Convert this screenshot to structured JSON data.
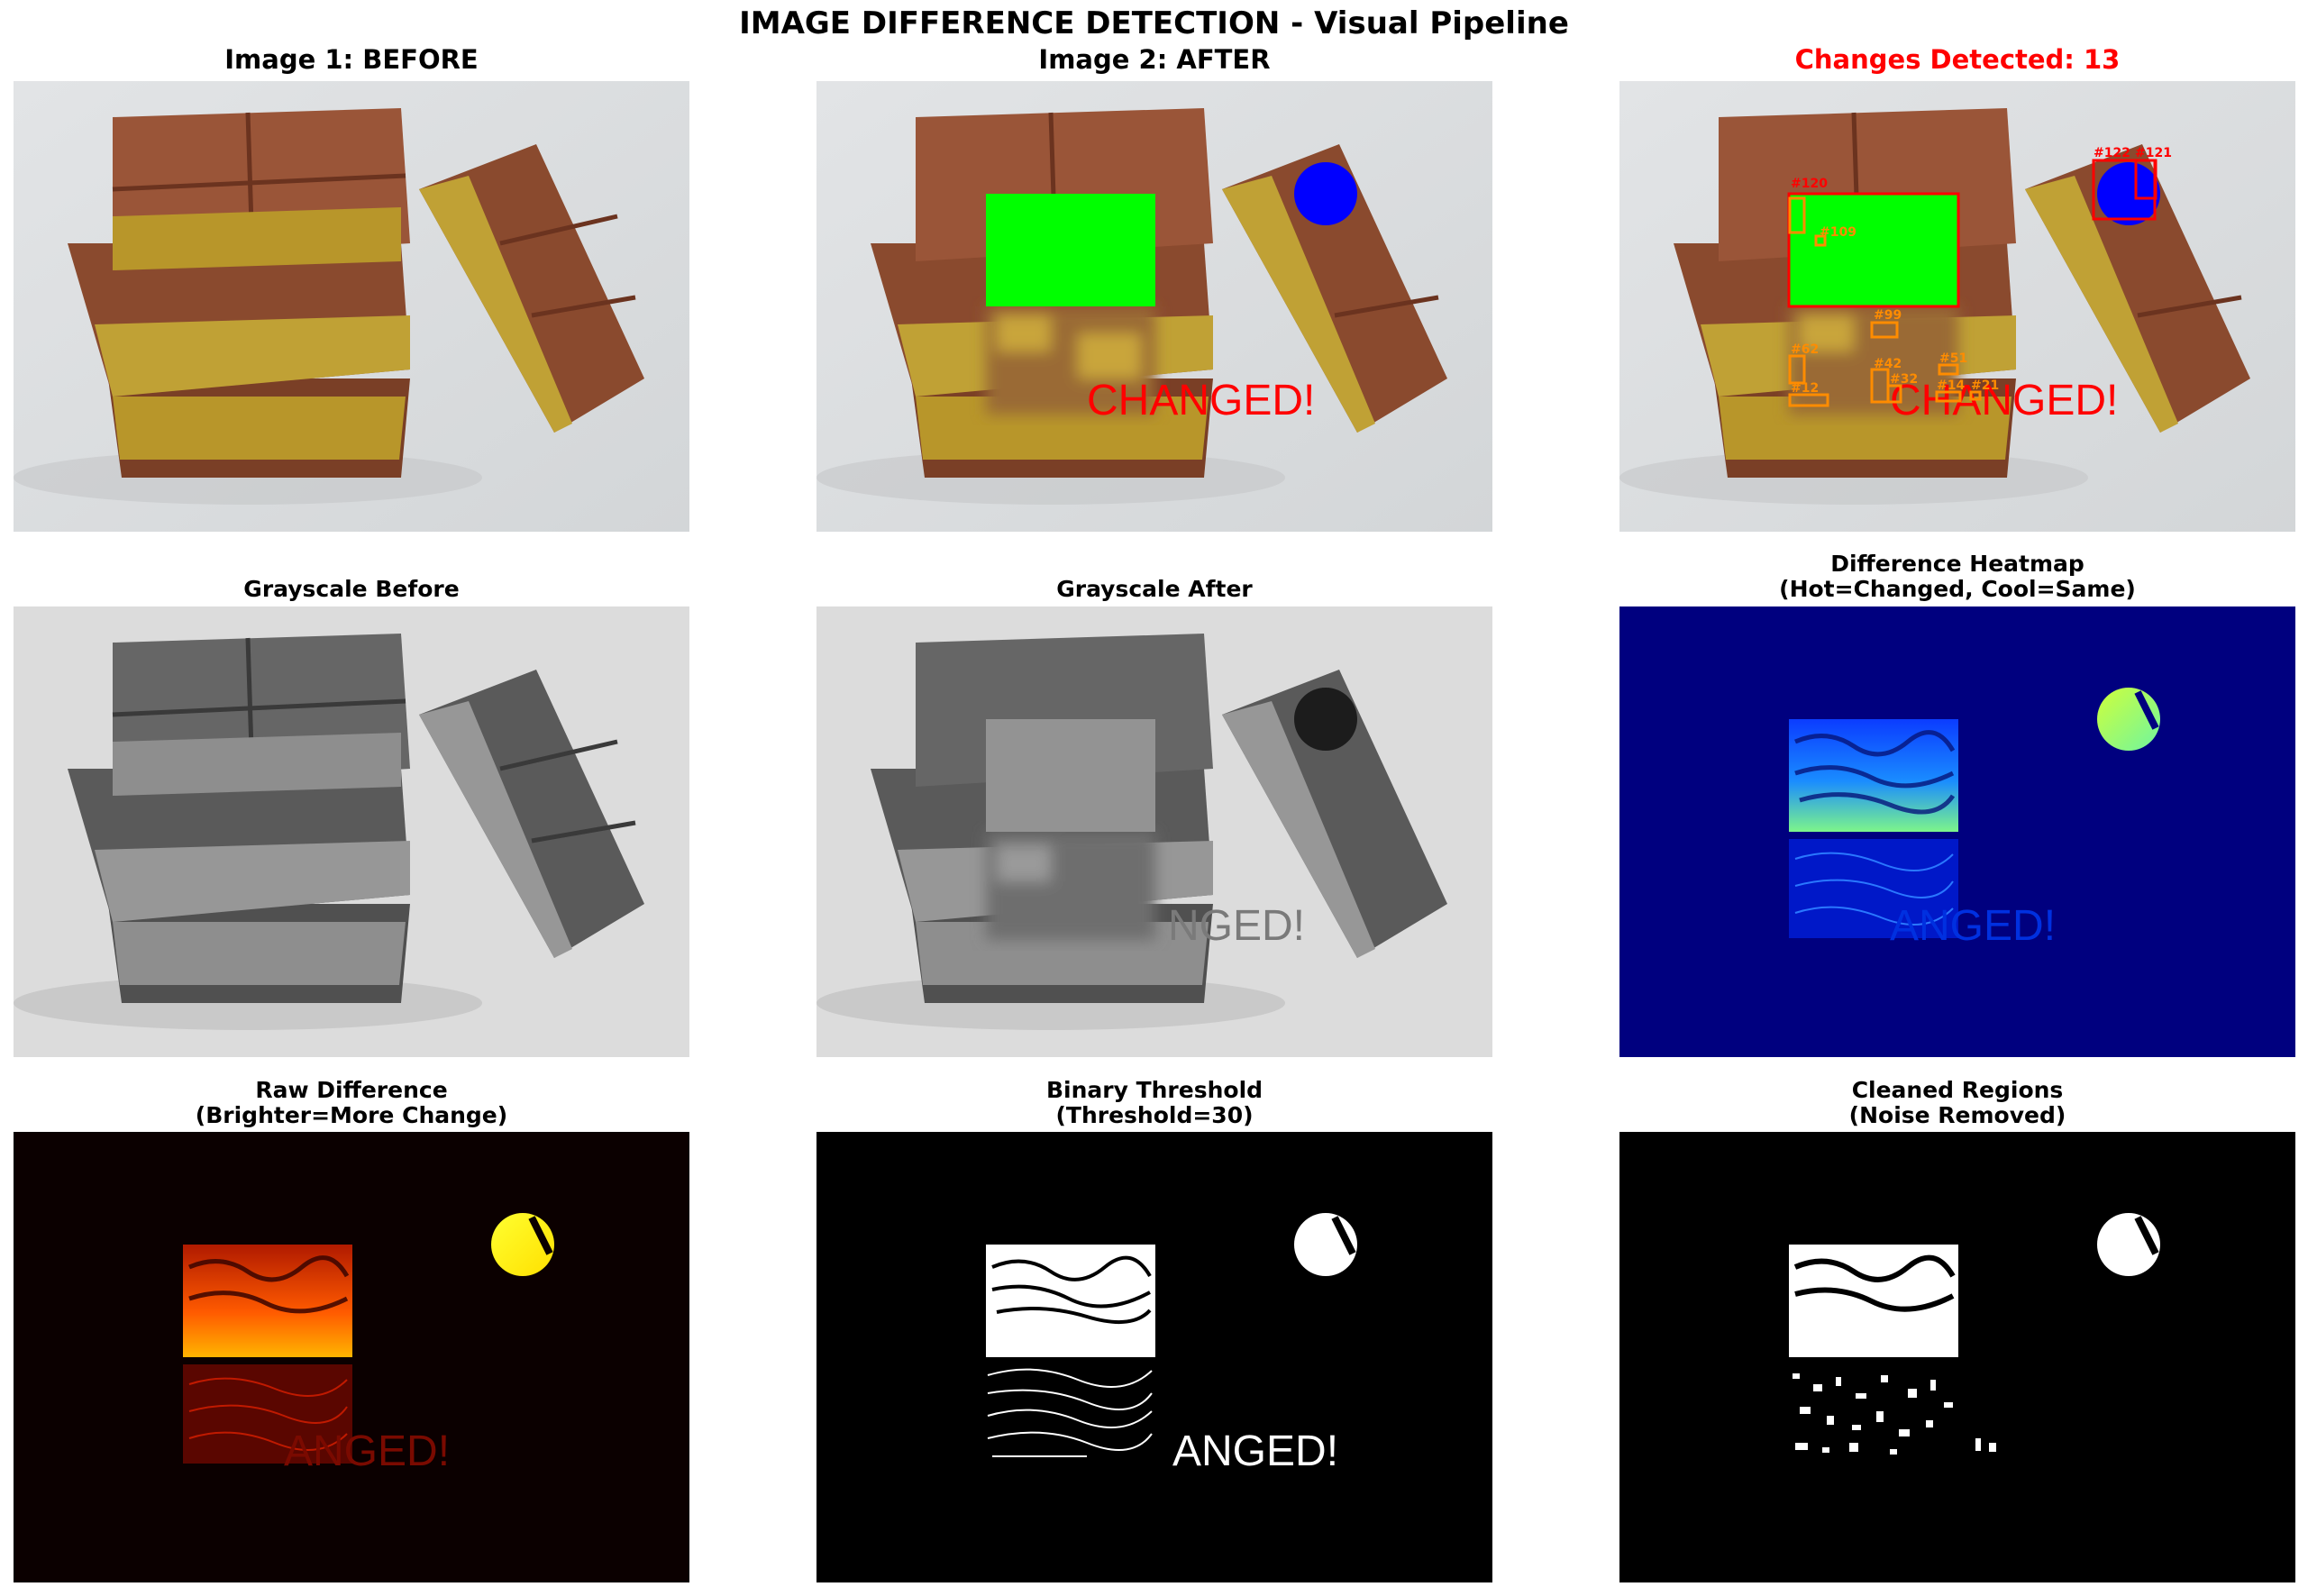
{
  "suptitle": "IMAGE DIFFERENCE DETECTION - Visual Pipeline",
  "panels": {
    "before": {
      "title": "Image 1: BEFORE"
    },
    "after": {
      "title": "Image 2: AFTER",
      "overlay_text": "CHANGED!"
    },
    "detected": {
      "title": "Changes Detected: 13",
      "title_color": "#ff0000",
      "overlay_text": "CHANGED!",
      "region_labels": [
        "#120",
        "#109",
        "#122",
        "#121",
        "#99",
        "#62",
        "#42",
        "#51",
        "#12",
        "#32",
        "#14",
        "#21"
      ]
    },
    "gray_before": {
      "title": "Grayscale Before"
    },
    "gray_after": {
      "title": "Grayscale After",
      "overlay_text": "NGED!"
    },
    "heatmap": {
      "title_line1": "Difference Heatmap",
      "title_line2": "(Hot=Changed, Cool=Same)",
      "overlay_text": "ANGED!"
    },
    "raw": {
      "title_line1": "Raw Difference",
      "title_line2": "(Brighter=More Change)",
      "overlay_text": "ANGED!"
    },
    "binary": {
      "title_line1": "Binary Threshold",
      "title_line2": "(Threshold=30)",
      "overlay_text": "ANGED!"
    },
    "cleaned": {
      "title_line1": "Cleaned Regions",
      "title_line2": "(Noise Removed)"
    }
  },
  "colors": {
    "changed_fill": "#00ff00",
    "circle_fill": "#0000ff",
    "box_major": "#ff0000",
    "box_minor": "#ff8c00",
    "heat_background": "#00007f"
  }
}
